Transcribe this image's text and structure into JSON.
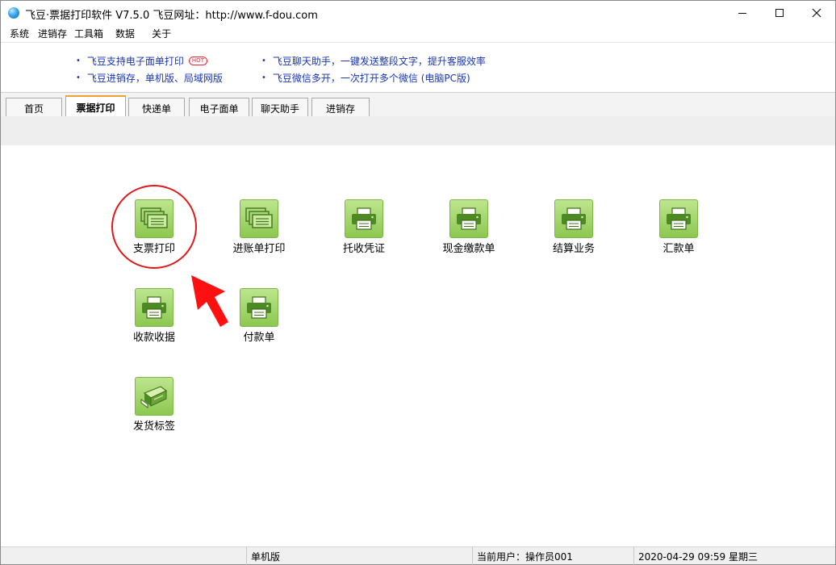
{
  "window": {
    "title": "飞豆·票据打印软件 V7.5.0   飞豆网址：http://www.f-dou.com"
  },
  "menu": [
    "系统",
    "进销存",
    "工具箱",
    "数据",
    "关于"
  ],
  "ads": {
    "left": [
      "飞豆支持电子面单打印",
      "飞豆进销存，单机版、局域网版"
    ],
    "right": [
      "飞豆聊天助手，一键发送整段文字，提升客服效率",
      "飞豆微信多开，一次打开多个微信 (电脑PC版)"
    ],
    "hot_badge": "HOT"
  },
  "tabs": [
    "首页",
    "票据打印",
    "快递单",
    "电子面单",
    "聊天助手",
    "进销存"
  ],
  "active_tab": "票据打印",
  "tiles": [
    {
      "label": "支票打印",
      "icon": "stacked-forms-icon"
    },
    {
      "label": "进账单打印",
      "icon": "stacked-forms-icon"
    },
    {
      "label": "托收凭证",
      "icon": "printer-icon"
    },
    {
      "label": "现金缴款单",
      "icon": "printer-icon"
    },
    {
      "label": "结算业务",
      "icon": "printer-icon"
    },
    {
      "label": "汇款单",
      "icon": "printer-icon"
    },
    {
      "label": "收款收据",
      "icon": "printer-icon"
    },
    {
      "label": "付款单",
      "icon": "printer-icon"
    },
    {
      "label": "发货标签",
      "icon": "label-printer-icon"
    }
  ],
  "status": {
    "edition": "单机版",
    "user": "当前用户：操作员001",
    "datetime": "2020-04-29 09:59 星期三"
  },
  "colors": {
    "accent_tab": "#f0a030",
    "link": "#1a36b0",
    "tile_green": "#8cc850",
    "annotation_red": "#e01919"
  }
}
